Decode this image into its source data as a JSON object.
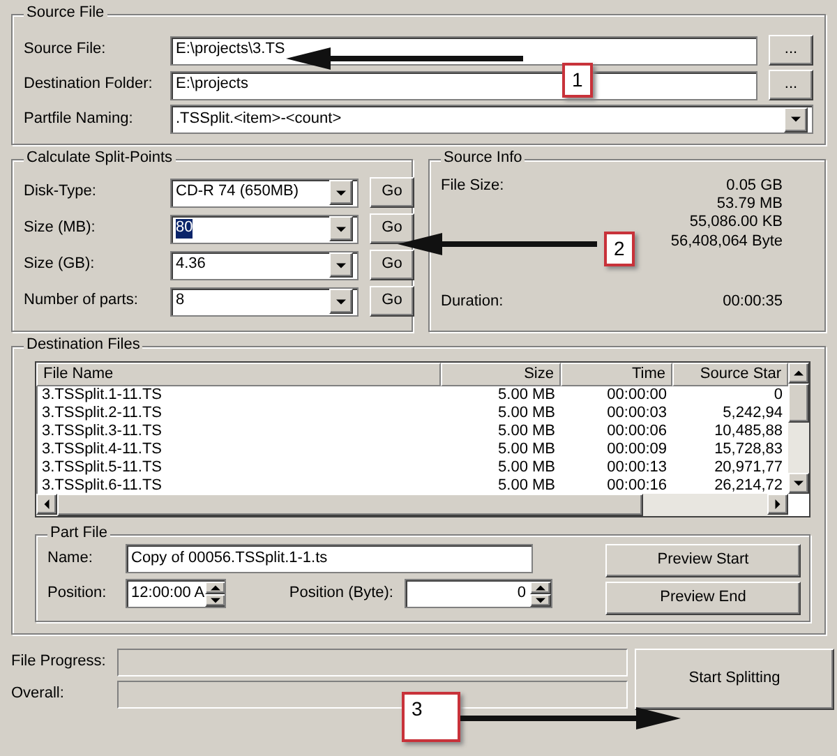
{
  "source_file": {
    "title": "Source File",
    "rows": [
      {
        "kind": "browse",
        "label": "Source File:",
        "value": "E:\\projects\\3.TS",
        "button": "..."
      },
      {
        "kind": "browse",
        "label": "Destination Folder:",
        "value": "E:\\projects",
        "button": "..."
      },
      {
        "kind": "dropdown",
        "label": "Partfile Naming:",
        "value": ".TSSplit.<item>-<count>"
      }
    ]
  },
  "split_points": {
    "title": "Calculate Split-Points",
    "rows": [
      {
        "label": "Disk-Type:",
        "value": "CD-R 74 (650MB)",
        "text_selected": false,
        "button": "Go"
      },
      {
        "label": "Size (MB):",
        "value": "80",
        "text_selected": true,
        "button": "Go"
      },
      {
        "label": "Size (GB):",
        "value": "4.36",
        "text_selected": false,
        "button": "Go"
      },
      {
        "label": "Number of parts:",
        "value": "8",
        "text_selected": false,
        "button": "Go"
      }
    ]
  },
  "source_info": {
    "title": "Source Info",
    "rows": [
      {
        "label": "File Size:",
        "values": [
          "0.05 GB",
          "53.79 MB",
          "55,086.00 KB",
          "56,408,064 Byte"
        ]
      },
      {
        "label": "Duration:",
        "values": [
          "00:00:35"
        ]
      }
    ]
  },
  "destination_files": {
    "title": "Destination Files",
    "columns": [
      "File Name",
      "Size",
      "Time",
      "Source Star"
    ],
    "rows": [
      [
        "3.TSSplit.1-11.TS",
        "5.00 MB",
        "00:00:00",
        "0"
      ],
      [
        "3.TSSplit.2-11.TS",
        "5.00 MB",
        "00:00:03",
        "5,242,94"
      ],
      [
        "3.TSSplit.3-11.TS",
        "5.00 MB",
        "00:00:06",
        "10,485,88"
      ],
      [
        "3.TSSplit.4-11.TS",
        "5.00 MB",
        "00:00:09",
        "15,728,83"
      ],
      [
        "3.TSSplit.5-11.TS",
        "5.00 MB",
        "00:00:13",
        "20,971,77"
      ],
      [
        "3.TSSplit.6-11.TS",
        "5.00 MB",
        "00:00:16",
        "26,214,72"
      ]
    ]
  },
  "part_file": {
    "title": "Part File",
    "name_label": "Name:",
    "name_value": "Copy of 00056.TSSplit.1-1.ts",
    "position_label": "Position:",
    "position_value": "12:00:00 A",
    "byte_label": "Position (Byte):",
    "byte_value": "0",
    "buttons": [
      "Preview Start",
      "Preview End"
    ]
  },
  "progress": [
    {
      "label": "File Progress:",
      "level": 0
    },
    {
      "label": "Overall:",
      "level": 0
    }
  ],
  "start_button": "Start Splitting",
  "annotations": [
    {
      "number": "1"
    },
    {
      "number": "2"
    },
    {
      "number": "3"
    }
  ]
}
